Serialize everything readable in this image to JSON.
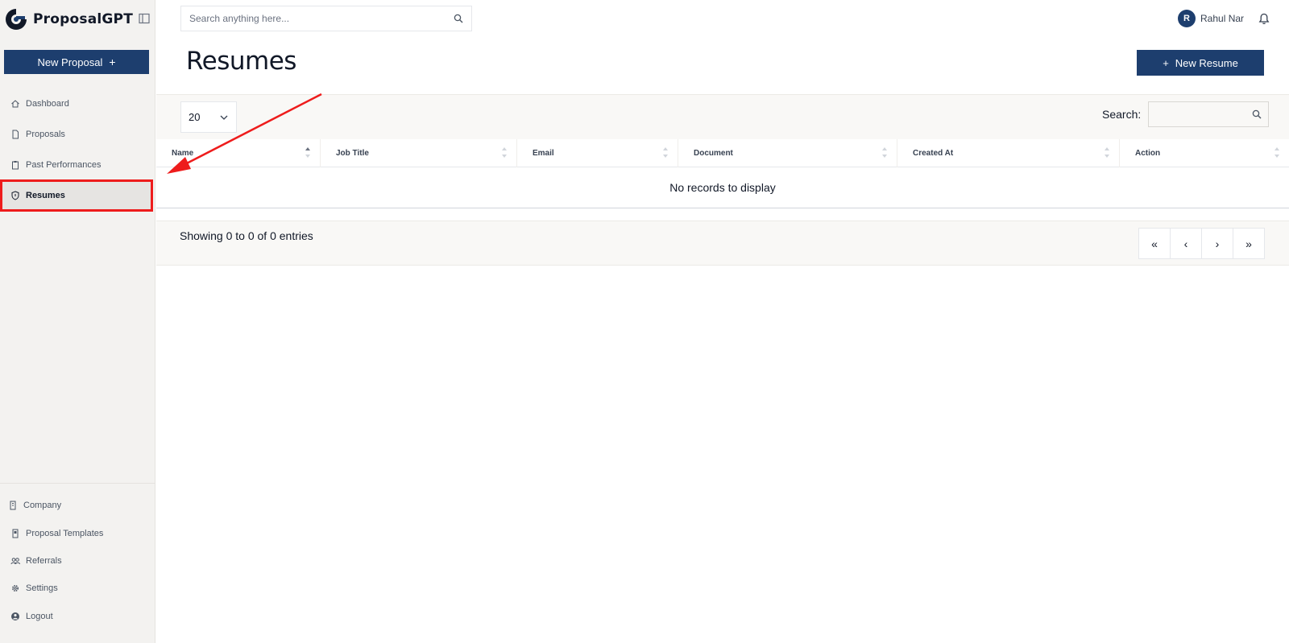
{
  "app": {
    "brand_name": "ProposalGPT",
    "accent_color": "#1d3e6e",
    "annotation_color": "#ee1c1c"
  },
  "sidebar": {
    "new_proposal_label": "New Proposal",
    "items": [
      {
        "label": "Dashboard",
        "icon": "home-icon"
      },
      {
        "label": "Proposals",
        "icon": "document-icon"
      },
      {
        "label": "Past Performances",
        "icon": "clipboard-icon"
      },
      {
        "label": "Resumes",
        "icon": "shield-icon",
        "active": true
      }
    ],
    "bottom_items": [
      {
        "label": "Company",
        "icon": "building-icon"
      },
      {
        "label": "Proposal Templates",
        "icon": "template-icon"
      },
      {
        "label": "Referrals",
        "icon": "users-icon"
      },
      {
        "label": "Settings",
        "icon": "gear-icon"
      },
      {
        "label": "Logout",
        "icon": "logout-icon"
      }
    ]
  },
  "header": {
    "search_placeholder": "Search anything here...",
    "user_initial": "R",
    "user_name": "Rahul Nar"
  },
  "page": {
    "title": "Resumes",
    "new_resume_label": "New Resume"
  },
  "table": {
    "page_size": "20",
    "search_label": "Search:",
    "columns": [
      "Name",
      "Job Title",
      "Email",
      "Document",
      "Created At",
      "Action"
    ],
    "empty_message": "No records to display",
    "info": "Showing 0 to 0 of 0 entries",
    "pager": {
      "first": "«",
      "prev": "‹",
      "next": "›",
      "last": "»"
    }
  }
}
